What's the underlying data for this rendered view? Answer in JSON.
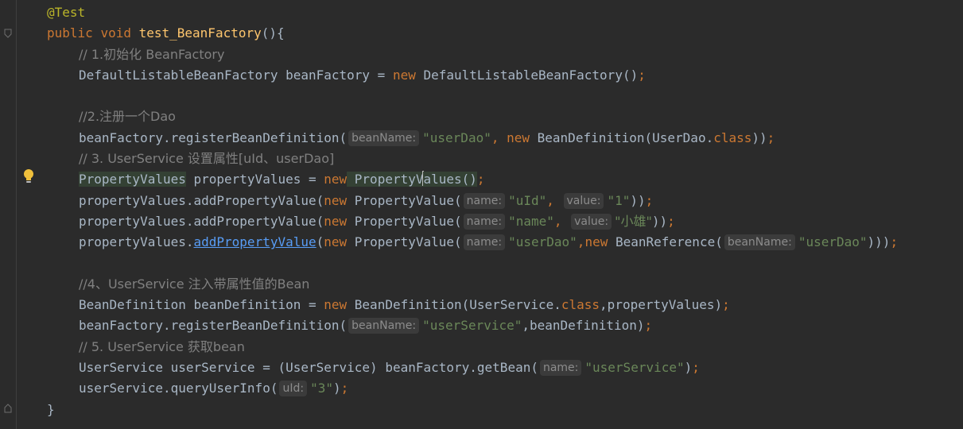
{
  "code": {
    "l1": {
      "annotation": "@Test"
    },
    "l2": {
      "kw_public": "public",
      "kw_void": "void",
      "method": "test_BeanFactory",
      "rest": "(){"
    },
    "l3": {
      "comment": "// 1.初始化 BeanFactory"
    },
    "l4": {
      "a": "DefaultListableBeanFactory beanFactory = ",
      "kw_new": "new",
      "b": " DefaultListableBeanFactory()",
      "semi": ";"
    },
    "l6": {
      "comment": "//2.注册一个Dao"
    },
    "l7": {
      "a": "beanFactory.registerBeanDefinition(",
      "hint": "beanName:",
      "str": "\"userDao\"",
      "comma": ", ",
      "kw_new": "new",
      "b": " BeanDefinition(UserDao.",
      "kw_class": "class",
      "c": "))",
      "semi": ";"
    },
    "l8": {
      "comment": "// 3. UserService 设置属性[uId、userDao]"
    },
    "l9": {
      "a": "PropertyValues",
      "b": " propertyValues = ",
      "kw_new": "new",
      "c_pre": " PropertyV",
      "c_post": "alues()",
      "semi": ";"
    },
    "l10": {
      "a": "propertyValues.addPropertyValue(",
      "kw_new": "new",
      "b": " PropertyValue(",
      "hint1": "name:",
      "str1": "\"uId\"",
      "comma": ", ",
      "hint2": "value:",
      "str2": "\"1\"",
      "c": "))",
      "semi": ";"
    },
    "l11": {
      "a": "propertyValues.addPropertyValue(",
      "kw_new": "new",
      "b": " PropertyValue(",
      "hint1": "name:",
      "str1": "\"name\"",
      "comma": ", ",
      "hint2": "value:",
      "str2": "\"小雄\"",
      "c": "))",
      "semi": ";"
    },
    "l12": {
      "a": "propertyValues.",
      "link": "addPropertyValue",
      "b": "(",
      "kw_new": "new",
      "c": " PropertyValue(",
      "hint1": "name:",
      "str1": "\"userDao\"",
      "comma": ",",
      "kw_new2": "new",
      "d": " BeanReference(",
      "hint2": "beanName:",
      "str2": "\"userDao\"",
      "e": ")))",
      "semi": ";"
    },
    "l14": {
      "comment": "//4、UserService 注入带属性值的Bean"
    },
    "l15": {
      "a": "BeanDefinition beanDefinition = ",
      "kw_new": "new",
      "b": " BeanDefinition(UserService.",
      "kw_class": "class",
      "c": ",propertyValues)",
      "semi": ";"
    },
    "l16": {
      "a": "beanFactory.registerBeanDefinition(",
      "hint": "beanName:",
      "str": "\"userService\"",
      "b": ",beanDefinition)",
      "semi": ";"
    },
    "l17": {
      "comment": "// 5. UserService 获取bean"
    },
    "l18": {
      "a": "UserService userService = (UserService) beanFactory.getBean(",
      "hint": "name:",
      "str": "\"userService\"",
      "b": ")",
      "semi": ";"
    },
    "l19": {
      "a": "userService.queryUserInfo(",
      "hint": "uId:",
      "str": "\"3\"",
      "b": ")",
      "semi": ";"
    },
    "l20": {
      "brace": "}"
    }
  },
  "icons": {
    "bulb": "lightbulb-icon",
    "fold": "fold-marker-icon"
  },
  "colors": {
    "background": "#2b2b2b",
    "keyword": "#cc7832",
    "string": "#6a8759",
    "comment": "#808080",
    "method": "#ffc66d",
    "annotation": "#bbb529",
    "text": "#a9b7c6",
    "link": "#589df6",
    "bulb": "#f0c03c"
  }
}
